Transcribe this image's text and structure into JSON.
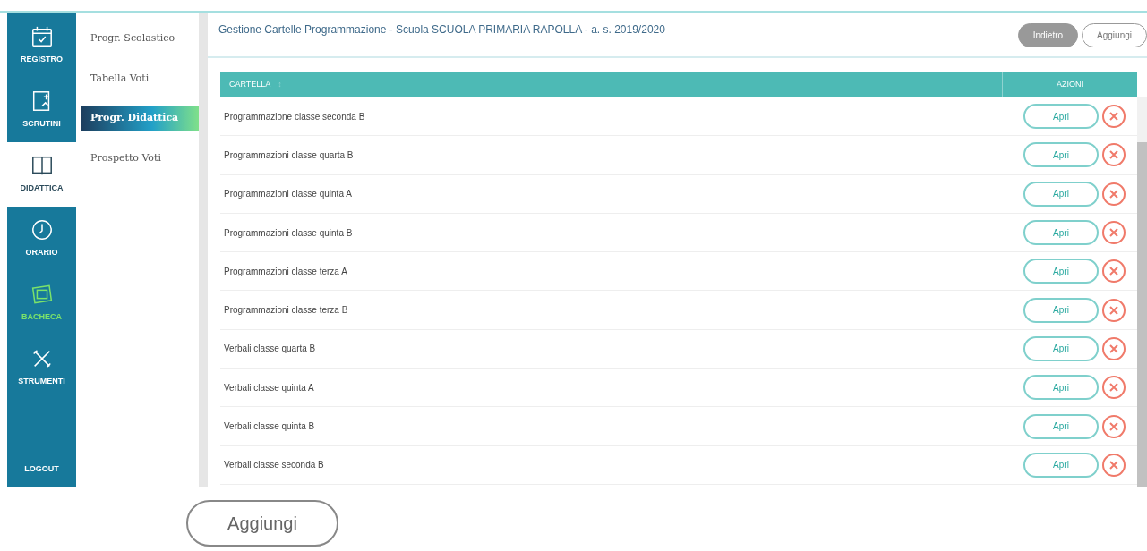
{
  "rail": [
    {
      "kind": "calendar",
      "label": "REGISTRO",
      "selected": false,
      "highlighted": false
    },
    {
      "kind": "doc",
      "label": "SCRUTINI",
      "selected": false,
      "highlighted": false
    },
    {
      "kind": "book",
      "label": "DIDATTICA",
      "selected": true,
      "highlighted": false
    },
    {
      "kind": "clock",
      "label": "ORARIO",
      "selected": false,
      "highlighted": false
    },
    {
      "kind": "board",
      "label": "BACHECA",
      "selected": false,
      "highlighted": true
    },
    {
      "kind": "tools",
      "label": "STRUMENTI",
      "selected": false,
      "highlighted": false
    },
    {
      "kind": "logout",
      "label": "LOGOUT",
      "selected": false,
      "highlighted": false
    }
  ],
  "submenu": [
    {
      "label": "Progr. Scolastico",
      "selected": false
    },
    {
      "label": "Tabella Voti",
      "selected": false
    },
    {
      "label": "Progr. Didattica",
      "selected": true
    },
    {
      "label": "Prospetto Voti",
      "selected": false
    }
  ],
  "header": {
    "title": "Gestione Cartelle Programmazione - Scuola SCUOLA PRIMARIA RAPOLLA - a. s. 2019/2020",
    "buttons": [
      {
        "label": "Indietro",
        "kind": "filled"
      },
      {
        "label": "Aggiungi",
        "kind": "outline"
      }
    ]
  },
  "table": {
    "columns": [
      "CARTELLA",
      "AZIONI"
    ],
    "sort_mark": "↕",
    "rows": [
      {
        "name": "Programmazione classe seconda B",
        "action": "Apri"
      },
      {
        "name": "Programmazioni classe quarta B",
        "action": "Apri"
      },
      {
        "name": "Programmazioni classe quinta A",
        "action": "Apri"
      },
      {
        "name": "Programmazioni classe quinta B",
        "action": "Apri"
      },
      {
        "name": "Programmazioni classe terza A",
        "action": "Apri"
      },
      {
        "name": "Programmazioni classe terza B",
        "action": "Apri"
      },
      {
        "name": "Verbali classe quarta B",
        "action": "Apri"
      },
      {
        "name": "Verbali classe quinta A",
        "action": "Apri"
      },
      {
        "name": "Verbali classe quinta B",
        "action": "Apri"
      },
      {
        "name": "Verbali classe seconda B",
        "action": "Apri"
      }
    ]
  },
  "footer_button": "Aggiungi"
}
